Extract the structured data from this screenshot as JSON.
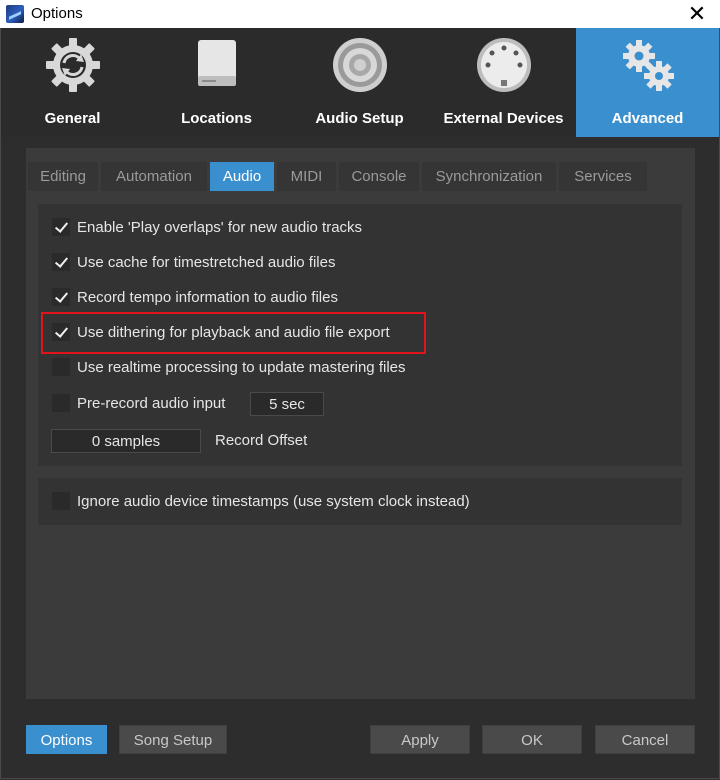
{
  "window": {
    "title": "Options",
    "close_glyph": "✕"
  },
  "categories": [
    {
      "label": "General",
      "icon": "gear-refresh-icon"
    },
    {
      "label": "Locations",
      "icon": "hard-drive-icon"
    },
    {
      "label": "Audio Setup",
      "icon": "speaker-icon"
    },
    {
      "label": "External Devices",
      "icon": "midi-connector-icon"
    },
    {
      "label": "Advanced",
      "icon": "gears-icon",
      "active": true
    }
  ],
  "tabs": [
    {
      "label": "Editing"
    },
    {
      "label": "Automation"
    },
    {
      "label": "Audio",
      "active": true
    },
    {
      "label": "MIDI"
    },
    {
      "label": "Console"
    },
    {
      "label": "Synchronization"
    },
    {
      "label": "Services"
    }
  ],
  "audio_options": [
    {
      "label": "Enable 'Play overlaps' for new audio tracks",
      "checked": true
    },
    {
      "label": "Use cache for timestretched audio files",
      "checked": true
    },
    {
      "label": "Record tempo information to audio files",
      "checked": true
    },
    {
      "label": "Use dithering for playback and audio file export",
      "checked": true
    },
    {
      "label": "Use realtime processing to update mastering files",
      "checked": false
    }
  ],
  "prerecord": {
    "label": "Pre-record audio input",
    "checked": false,
    "value": "5 sec"
  },
  "record_offset": {
    "value": "0 samples",
    "label": "Record Offset"
  },
  "ignore_timestamps": {
    "label": "Ignore audio device timestamps (use system clock instead)",
    "checked": false
  },
  "footer": {
    "options_label": "Options",
    "song_setup_label": "Song Setup",
    "apply_label": "Apply",
    "ok_label": "OK",
    "cancel_label": "Cancel"
  },
  "colors": {
    "accent": "#3a8fcf",
    "highlight_box": "#e0141a",
    "background": "#2d2d2d"
  }
}
